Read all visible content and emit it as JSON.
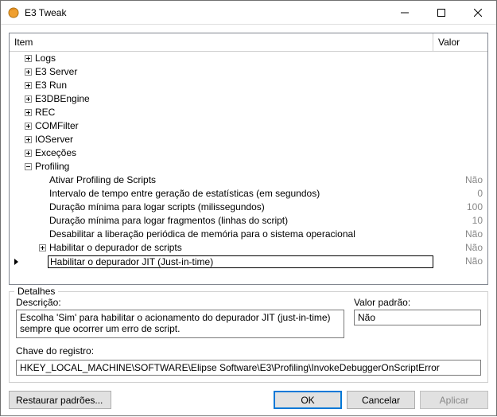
{
  "window": {
    "title": "E3 Tweak"
  },
  "grid": {
    "header_item": "Item",
    "header_value": "Valor",
    "top_nodes": [
      "Logs",
      "E3 Server",
      "E3 Run",
      "E3DBEngine",
      "REC",
      "COMFilter",
      "IOServer",
      "Exceções"
    ],
    "profiling_label": "Profiling",
    "profiling_children": [
      {
        "label": "Ativar Profiling de Scripts",
        "value": "Não"
      },
      {
        "label": "Intervalo de tempo entre geração de estatísticas (em segundos)",
        "value": "0"
      },
      {
        "label": "Duração mínima para logar scripts (milissegundos)",
        "value": "100"
      },
      {
        "label": "Duração mínima para logar fragmentos (linhas do script)",
        "value": "10"
      },
      {
        "label": "Desabilitar a liberação periódica de memória para o sistema operacional",
        "value": "Não"
      }
    ],
    "sub_expandable": {
      "label": "Habilitar o depurador de scripts",
      "value": "Não"
    },
    "selected": {
      "label": "Habilitar o depurador JIT (Just-in-time)",
      "value": "Não"
    }
  },
  "details": {
    "group_label": "Detalhes",
    "desc_label": "Descrição:",
    "desc_value": "Escolha 'Sim' para habilitar o acionamento do depurador JIT (just-in-time) sempre que ocorrer um erro de script.",
    "default_label": "Valor padrão:",
    "default_value": "Não",
    "regkey_label": "Chave do registro:",
    "regkey_value": "HKEY_LOCAL_MACHINE\\SOFTWARE\\Elipse Software\\E3\\Profiling\\InvokeDebuggerOnScriptError"
  },
  "buttons": {
    "restore": "Restaurar padrões...",
    "ok": "OK",
    "cancel": "Cancelar",
    "apply": "Aplicar"
  }
}
